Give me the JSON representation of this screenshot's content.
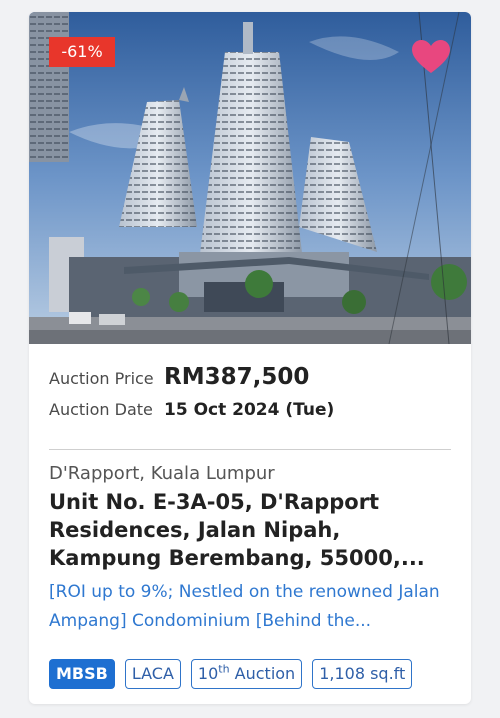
{
  "listing": {
    "discount": "-61%",
    "auction_price_label": "Auction Price",
    "auction_price": "RM387,500",
    "auction_date_label": "Auction Date",
    "auction_date": "15 Oct 2024 (Tue)",
    "location": "D'Rapport, Kuala Lumpur",
    "title": "Unit No. E-3A-05, D'Rapport Residences, Jalan Nipah, Kampung Berembang, 55000,...",
    "description": "[ROI up to 9%; Nestled on the renowned Jalan Ampang] Condominium [Behind the...",
    "tags": {
      "bank": "MBSB",
      "type": "LACA",
      "auction_num": "10",
      "auction_suffix": "th",
      "auction_word": "Auction",
      "size": "1,108 sq.ft"
    }
  },
  "icons": {
    "favorite": "heart-icon"
  },
  "colors": {
    "badge": "#e8362b",
    "heart": "#e8477f",
    "link": "#2f78d0",
    "tag_solid": "#1e6fd1"
  }
}
